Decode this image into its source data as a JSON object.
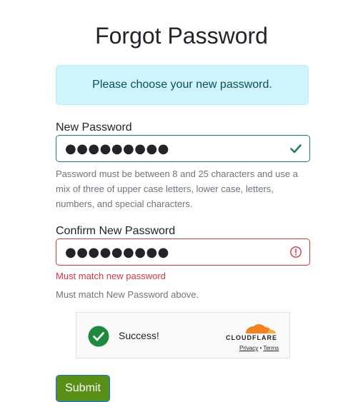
{
  "page": {
    "title": "Forgot Password"
  },
  "alert": {
    "message": "Please choose your new password."
  },
  "new_password": {
    "label": "New Password",
    "value": "●●●●●●●●●",
    "state": "valid",
    "icon": "check-icon",
    "help": "Password must be between 8 and 25 characters and use a mix of three of upper case letters, lower case, letters, numbers, and special characters."
  },
  "confirm_password": {
    "label": "Confirm New Password",
    "value": "●●●●●●●●●",
    "state": "invalid",
    "icon": "exclamation-circle-icon",
    "error": "Must match new password",
    "help": "Must match New Password above."
  },
  "captcha": {
    "status": "Success!",
    "provider": "CLOUDFLARE",
    "privacy_link": "Privacy",
    "separator": "•",
    "terms_link": "Terms"
  },
  "submit": {
    "label": "Submit"
  },
  "colors": {
    "valid": "#198754",
    "invalid": "#dc3545",
    "alert_bg": "#cff4fc",
    "submit_bg": "#5a8f16",
    "cloudflare_orange": "#f48120"
  }
}
